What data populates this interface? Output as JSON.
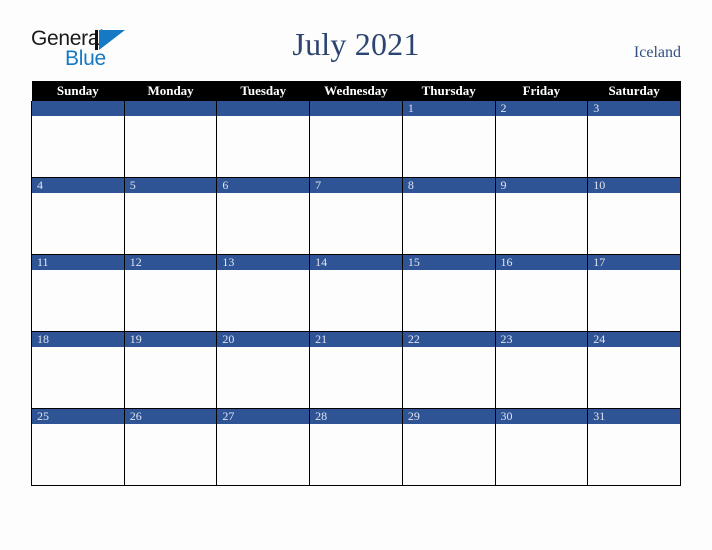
{
  "branding": {
    "logo_word_1": "General",
    "logo_word_2": "Blue",
    "logo_mark": "blue-triangle",
    "color_primary": "#1579c4",
    "color_dark": "#1a1a1a"
  },
  "header": {
    "title": "July 2021",
    "region": "Iceland",
    "title_color": "#2b4570",
    "region_color": "#33507f"
  },
  "calendar": {
    "month": "July",
    "year": "2021",
    "accent_blue": "#2f5496",
    "header_bg": "#000000",
    "weekday_headers": [
      "Sunday",
      "Monday",
      "Tuesday",
      "Wednesday",
      "Thursday",
      "Friday",
      "Saturday"
    ],
    "weeks": [
      [
        "",
        "",
        "",
        "",
        "1",
        "2",
        "3"
      ],
      [
        "4",
        "5",
        "6",
        "7",
        "8",
        "9",
        "10"
      ],
      [
        "11",
        "12",
        "13",
        "14",
        "15",
        "16",
        "17"
      ],
      [
        "18",
        "19",
        "20",
        "21",
        "22",
        "23",
        "24"
      ],
      [
        "25",
        "26",
        "27",
        "28",
        "29",
        "30",
        "31"
      ]
    ]
  }
}
